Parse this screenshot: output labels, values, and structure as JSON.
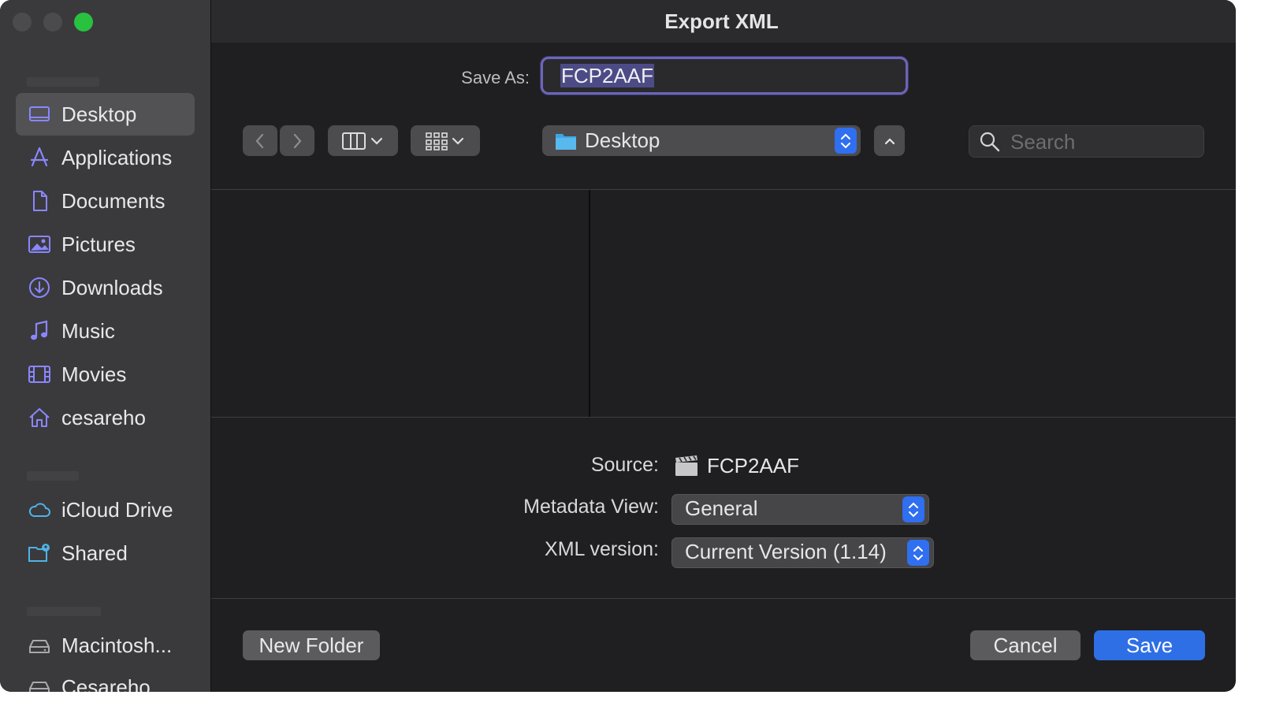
{
  "dialog": {
    "title": "Export XML"
  },
  "save_as": {
    "label": "Save As:",
    "value": "FCP2AAF"
  },
  "sidebar": {
    "items": [
      {
        "label": "Desktop",
        "icon": "desktop-icon",
        "selected": true
      },
      {
        "label": "Applications",
        "icon": "applications-icon"
      },
      {
        "label": "Documents",
        "icon": "document-icon"
      },
      {
        "label": "Pictures",
        "icon": "pictures-icon"
      },
      {
        "label": "Downloads",
        "icon": "downloads-icon"
      },
      {
        "label": "Music",
        "icon": "music-icon"
      },
      {
        "label": "Movies",
        "icon": "movies-icon"
      },
      {
        "label": "cesareho",
        "icon": "home-icon"
      }
    ],
    "cloud_items": [
      {
        "label": "iCloud Drive",
        "icon": "icloud-icon"
      },
      {
        "label": "Shared",
        "icon": "shared-folder-icon"
      }
    ],
    "location_items": [
      {
        "label": "Macintosh...",
        "icon": "disk-icon"
      },
      {
        "label": "Cesareho",
        "icon": "disk-icon"
      }
    ]
  },
  "toolbar": {
    "location": "Desktop",
    "search_placeholder": "Search"
  },
  "options": {
    "source_label": "Source:",
    "source_value": "FCP2AAF",
    "metadata_label": "Metadata View:",
    "metadata_value": "General",
    "xml_label": "XML version:",
    "xml_value": "Current Version (1.14)"
  },
  "buttons": {
    "new_folder": "New Folder",
    "cancel": "Cancel",
    "save": "Save"
  },
  "colors": {
    "accent": "#2e6fe6",
    "icon_tint": "#8a86ff",
    "traffic_green": "#29c140"
  }
}
